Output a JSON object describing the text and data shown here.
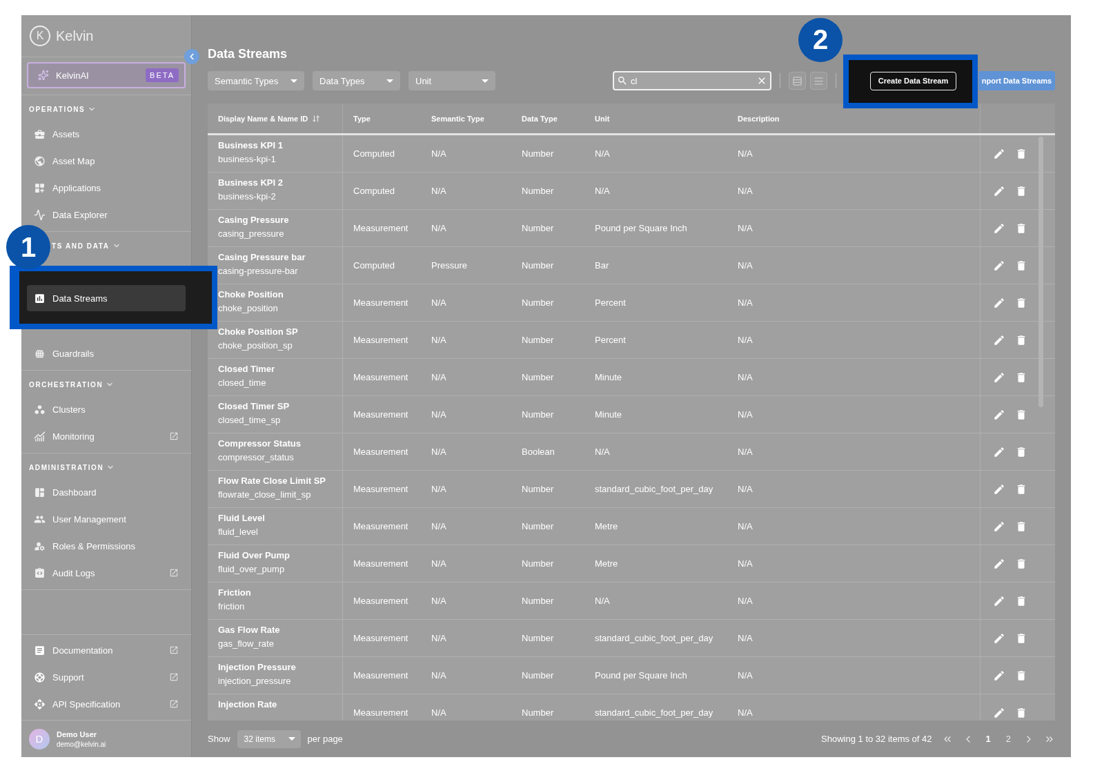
{
  "sidebar": {
    "logo_mark": "K",
    "logo": "Kelvin",
    "ai": {
      "label": "KelvinAI",
      "badge": "BETA"
    },
    "sections": [
      {
        "title": "OPERATIONS",
        "items": [
          {
            "label": "Assets",
            "external": false,
            "selected": false
          },
          {
            "label": "Asset Map",
            "external": false,
            "selected": false
          },
          {
            "label": "Applications",
            "external": false,
            "selected": false
          },
          {
            "label": "Data Explorer",
            "external": false,
            "selected": false
          }
        ]
      },
      {
        "title": "TS AND DATA",
        "items": [
          {
            "label": "Data Streams",
            "external": false,
            "selected": true,
            "highlighted": true
          },
          {
            "label": "Guardrails",
            "external": false,
            "selected": false
          }
        ]
      },
      {
        "title": "ORCHESTRATION",
        "items": [
          {
            "label": "Clusters",
            "external": false,
            "selected": false
          },
          {
            "label": "Monitoring",
            "external": true,
            "selected": false
          }
        ]
      },
      {
        "title": "ADMINISTRATION",
        "items": [
          {
            "label": "Dashboard",
            "external": false,
            "selected": false
          },
          {
            "label": "User Management",
            "external": false,
            "selected": false
          },
          {
            "label": "Roles & Permissions",
            "external": false,
            "selected": false
          },
          {
            "label": "Audit Logs",
            "external": true,
            "selected": false
          }
        ]
      }
    ],
    "links": [
      {
        "label": "Documentation",
        "external": true
      },
      {
        "label": "Support",
        "external": true
      },
      {
        "label": "API Specification",
        "external": true
      }
    ],
    "user": {
      "initial": "D",
      "name": "Demo User",
      "email": "demo@kelvin.ai"
    }
  },
  "steps": [
    {
      "number": "1"
    },
    {
      "number": "2"
    }
  ],
  "page": {
    "title": "Data Streams",
    "filters": [
      {
        "placeholder": "Semantic Types"
      },
      {
        "placeholder": "Data Types"
      },
      {
        "placeholder": "Unit"
      }
    ],
    "search": {
      "value": "cl"
    },
    "create_button": "Create Data Stream",
    "import_button": "nport Data Streams"
  },
  "table": {
    "columns": [
      "Display Name & Name ID",
      "Type",
      "Semantic Type",
      "Data Type",
      "Unit",
      "Description"
    ],
    "rows": [
      {
        "name": "Business KPI 1",
        "id": "business-kpi-1",
        "type": "Computed",
        "semantic_type": "N/A",
        "data_type": "Number",
        "unit": "N/A",
        "description": "N/A"
      },
      {
        "name": "Business KPI 2",
        "id": "business-kpi-2",
        "type": "Computed",
        "semantic_type": "N/A",
        "data_type": "Number",
        "unit": "N/A",
        "description": "N/A"
      },
      {
        "name": "Casing Pressure",
        "id": "casing_pressure",
        "type": "Measurement",
        "semantic_type": "N/A",
        "data_type": "Number",
        "unit": "Pound per Square Inch",
        "description": "N/A"
      },
      {
        "name": "Casing Pressure bar",
        "id": "casing-pressure-bar",
        "type": "Computed",
        "semantic_type": "Pressure",
        "data_type": "Number",
        "unit": "Bar",
        "description": "N/A"
      },
      {
        "name": "Choke Position",
        "id": "choke_position",
        "type": "Measurement",
        "semantic_type": "N/A",
        "data_type": "Number",
        "unit": "Percent",
        "description": "N/A"
      },
      {
        "name": "Choke Position SP",
        "id": "choke_position_sp",
        "type": "Measurement",
        "semantic_type": "N/A",
        "data_type": "Number",
        "unit": "Percent",
        "description": "N/A"
      },
      {
        "name": "Closed Timer",
        "id": "closed_time",
        "type": "Measurement",
        "semantic_type": "N/A",
        "data_type": "Number",
        "unit": "Minute",
        "description": "N/A"
      },
      {
        "name": "Closed Timer SP",
        "id": "closed_time_sp",
        "type": "Measurement",
        "semantic_type": "N/A",
        "data_type": "Number",
        "unit": "Minute",
        "description": "N/A"
      },
      {
        "name": "Compressor Status",
        "id": "compressor_status",
        "type": "Measurement",
        "semantic_type": "N/A",
        "data_type": "Boolean",
        "unit": "N/A",
        "description": "N/A"
      },
      {
        "name": "Flow Rate Close Limit SP",
        "id": "flowrate_close_limit_sp",
        "type": "Measurement",
        "semantic_type": "N/A",
        "data_type": "Number",
        "unit": "standard_cubic_foot_per_day",
        "description": "N/A"
      },
      {
        "name": "Fluid Level",
        "id": "fluid_level",
        "type": "Measurement",
        "semantic_type": "N/A",
        "data_type": "Number",
        "unit": "Metre",
        "description": "N/A"
      },
      {
        "name": "Fluid Over Pump",
        "id": "fluid_over_pump",
        "type": "Measurement",
        "semantic_type": "N/A",
        "data_type": "Number",
        "unit": "Metre",
        "description": "N/A"
      },
      {
        "name": "Friction",
        "id": "friction",
        "type": "Measurement",
        "semantic_type": "N/A",
        "data_type": "Number",
        "unit": "N/A",
        "description": "N/A"
      },
      {
        "name": "Gas Flow Rate",
        "id": "gas_flow_rate",
        "type": "Measurement",
        "semantic_type": "N/A",
        "data_type": "Number",
        "unit": "standard_cubic_foot_per_day",
        "description": "N/A"
      },
      {
        "name": "Injection Pressure",
        "id": "injection_pressure",
        "type": "Measurement",
        "semantic_type": "N/A",
        "data_type": "Number",
        "unit": "Pound per Square Inch",
        "description": "N/A"
      },
      {
        "name": "Injection Rate",
        "type": "Measurement",
        "semantic_type": "N/A",
        "data_type": "Number",
        "unit": "standard_cubic_foot_per_day",
        "description": "N/A"
      }
    ]
  },
  "footer": {
    "show_label": "Show",
    "page_size": "32 items",
    "per_page_label": "per page",
    "summary": "Showing 1 to 32 items of 42",
    "pages": [
      {
        "label": "1",
        "selected": true
      },
      {
        "label": "2",
        "selected": false
      }
    ]
  }
}
